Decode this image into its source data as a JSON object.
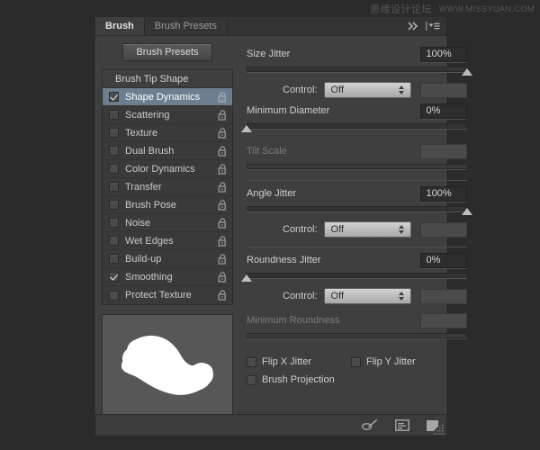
{
  "watermark": {
    "chinese": "思缘设计论坛",
    "url": "WWW.MISSYUAN.COM"
  },
  "panel": {
    "tabs": [
      {
        "label": "Brush",
        "active": true
      },
      {
        "label": "Brush Presets",
        "active": false
      }
    ],
    "header_icons": [
      "collapse-chevrons-icon",
      "panel-menu-icon"
    ]
  },
  "left": {
    "presets_button": "Brush Presets",
    "list_header": "Brush Tip Shape",
    "items": [
      {
        "label": "Shape Dynamics",
        "checked": true,
        "selected": true
      },
      {
        "label": "Scattering",
        "checked": false,
        "selected": false
      },
      {
        "label": "Texture",
        "checked": false,
        "selected": false
      },
      {
        "label": "Dual Brush",
        "checked": false,
        "selected": false
      },
      {
        "label": "Color Dynamics",
        "checked": false,
        "selected": false
      },
      {
        "label": "Transfer",
        "checked": false,
        "selected": false
      },
      {
        "label": "Brush Pose",
        "checked": false,
        "selected": false
      },
      {
        "label": "Noise",
        "checked": false,
        "selected": false
      },
      {
        "label": "Wet Edges",
        "checked": false,
        "selected": false
      },
      {
        "label": "Build-up",
        "checked": false,
        "selected": false
      },
      {
        "label": "Smoothing",
        "checked": true,
        "selected": false
      },
      {
        "label": "Protect Texture",
        "checked": false,
        "selected": false
      }
    ],
    "lock_icon": "open-padlock-icon",
    "preview_name": "brush-stroke-preview"
  },
  "right": {
    "size_jitter": {
      "label": "Size Jitter",
      "value": "100%",
      "slider_percent": 100
    },
    "size_jitter_control": {
      "label": "Control:",
      "value": "Off"
    },
    "minimum_diameter": {
      "label": "Minimum Diameter",
      "value": "0%",
      "slider_percent": 0
    },
    "tilt_scale": {
      "label": "Tilt Scale",
      "value": "",
      "slider_percent": 0,
      "disabled": true
    },
    "angle_jitter": {
      "label": "Angle Jitter",
      "value": "100%",
      "slider_percent": 100
    },
    "angle_jitter_control": {
      "label": "Control:",
      "value": "Off"
    },
    "roundness_jitter": {
      "label": "Roundness Jitter",
      "value": "0%",
      "slider_percent": 0
    },
    "roundness_jitter_control": {
      "label": "Control:",
      "value": "Off"
    },
    "minimum_roundness": {
      "label": "Minimum Roundness",
      "value": "",
      "slider_percent": 0,
      "disabled": true
    },
    "flip_x": {
      "label": "Flip X Jitter",
      "checked": false
    },
    "flip_y": {
      "label": "Flip Y Jitter",
      "checked": false
    },
    "brush_projection": {
      "label": "Brush Projection",
      "checked": false
    }
  },
  "footer": {
    "icons": [
      "toggle-brush-options-icon",
      "brush-panel-icon",
      "new-brush-icon"
    ]
  },
  "colors": {
    "panel_bg": "#3f3f3f",
    "selection_blue": "#6d7e90",
    "tab_active_bg": "#3f3f3f",
    "value_box_bg": "#2d2d2d",
    "dropdown_light": "#d2d2d2"
  }
}
